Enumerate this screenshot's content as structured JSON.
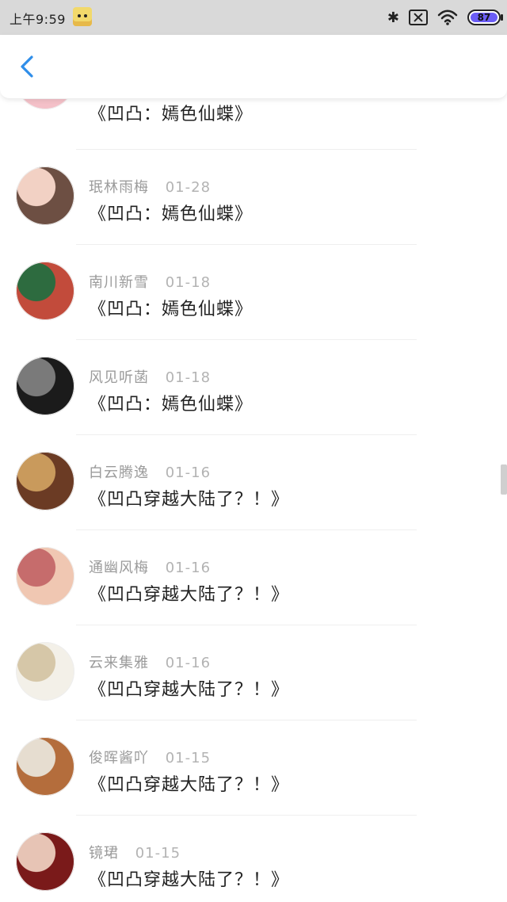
{
  "status_bar": {
    "time": "上午9:59",
    "battery": "87"
  },
  "header": {
    "back_icon": "chevron-left-icon",
    "accent": "#2f8ee9"
  },
  "list": {
    "items": [
      {
        "user": "",
        "date": "",
        "title": "《凹凸：嫣色仙蝶》",
        "avatar_colors": [
          "#f4c0c8",
          "#f0f0f0"
        ]
      },
      {
        "user": "珉林雨梅",
        "date": "01-28",
        "title": "《凹凸：嫣色仙蝶》",
        "avatar_colors": [
          "#6d4f43",
          "#f2d1c4"
        ]
      },
      {
        "user": "南川新雪",
        "date": "01-18",
        "title": "《凹凸：嫣色仙蝶》",
        "avatar_colors": [
          "#c24b3b",
          "#2d6b3f"
        ]
      },
      {
        "user": "风见听菡",
        "date": "01-18",
        "title": "《凹凸：嫣色仙蝶》",
        "avatar_colors": [
          "#1b1b1b",
          "#7a7a7a"
        ]
      },
      {
        "user": "白云腾逸",
        "date": "01-16",
        "title": "《凹凸穿越大陆了？！》",
        "avatar_colors": [
          "#6b3b24",
          "#c99a5c"
        ]
      },
      {
        "user": "通幽风梅",
        "date": "01-16",
        "title": "《凹凸穿越大陆了？！》",
        "avatar_colors": [
          "#f0c7b2",
          "#c66c6c"
        ]
      },
      {
        "user": "云来集雅",
        "date": "01-16",
        "title": "《凹凸穿越大陆了？！》",
        "avatar_colors": [
          "#f3f0e8",
          "#d6c7a8"
        ]
      },
      {
        "user": "俊晖酱吖",
        "date": "01-15",
        "title": "《凹凸穿越大陆了？！》",
        "avatar_colors": [
          "#b46d3c",
          "#e6ddd0"
        ]
      },
      {
        "user": "镜珺",
        "date": "01-15",
        "title": "《凹凸穿越大陆了？！》",
        "avatar_colors": [
          "#7a1a1a",
          "#e7c4b5"
        ]
      }
    ]
  }
}
